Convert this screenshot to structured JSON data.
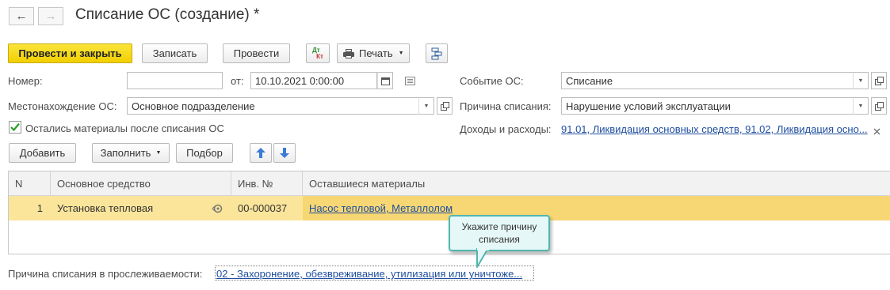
{
  "window": {
    "title": "Списание ОС (создание) *"
  },
  "toolbar": {
    "post_close_label": "Провести и закрыть",
    "save_label": "Записать",
    "post_label": "Провести",
    "dtkt_top": "Дт",
    "dtkt_bottom": "Кт",
    "print_label": "Печать"
  },
  "form": {
    "number_label": "Номер:",
    "number_value": "",
    "date_from_label": "от:",
    "date_value": "10.10.2021  0:00:00",
    "location_label": "Местонахождение ОС:",
    "location_value": "Основное подразделение",
    "materials_checkbox_label": "Остались материалы после списания ОС",
    "materials_checked": true,
    "event_label": "Событие ОС:",
    "event_value": "Списание",
    "reason_label": "Причина списания:",
    "reason_value": "Нарушение условий эксплуатации",
    "income_label": "Доходы и расходы:",
    "income_link": "91.01, Ликвидация основных средств, 91.02, Ликвидация осно..."
  },
  "table_toolbar": {
    "add_label": "Добавить",
    "fill_label": "Заполнить",
    "select_label": "Подбор"
  },
  "table": {
    "columns": [
      "N",
      "Основное средство",
      "Инв. №",
      "Оставшиеся материалы"
    ],
    "rows": [
      {
        "n": "1",
        "asset": "Установка тепловая",
        "inv": "00-000037",
        "materials": "Насос тепловой, Металлолом"
      }
    ]
  },
  "tooltip": {
    "text_line1": "Укажите причину",
    "text_line2": "списания"
  },
  "footer": {
    "trace_label": "Причина списания в прослеживаемости:",
    "trace_link": "02 - Захоронение, обезвреживание, утилизация или уничтоже..."
  },
  "colors": {
    "primary_button": "#f5d60e",
    "selected_row": "#fbe59b",
    "link": "#1f4ea0",
    "tooltip_border": "#4fb7b0",
    "checkbox_check": "#2a9d2a",
    "arrow_buttons": "#3a7bd5"
  }
}
